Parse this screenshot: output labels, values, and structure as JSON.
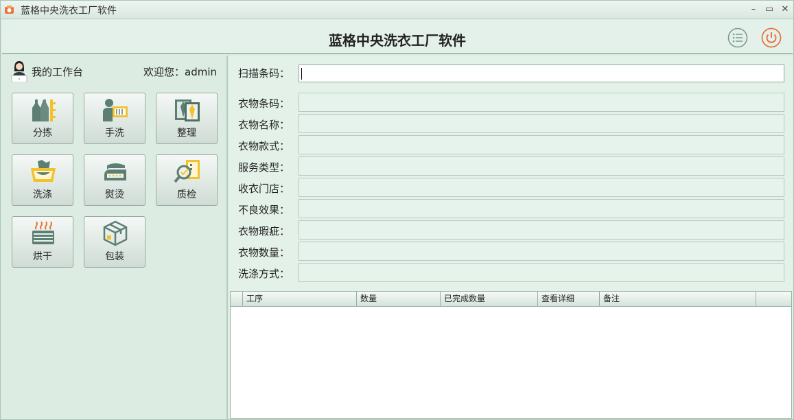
{
  "window": {
    "title": "蓝格中央洗衣工厂软件"
  },
  "header": {
    "title": "蓝格中央洗衣工厂软件",
    "menu_icon": "list-menu-icon",
    "power_icon": "power-icon"
  },
  "sidebar": {
    "workspace_label": "我的工作台",
    "welcome": "欢迎您：admin",
    "tiles": [
      {
        "label": "分拣",
        "icon": "sort-icon"
      },
      {
        "label": "手洗",
        "icon": "hand-wash-icon"
      },
      {
        "label": "整理",
        "icon": "tidy-icon"
      },
      {
        "label": "洗涤",
        "icon": "washing-icon"
      },
      {
        "label": "熨烫",
        "icon": "iron-icon"
      },
      {
        "label": "质检",
        "icon": "quality-check-icon"
      },
      {
        "label": "烘干",
        "icon": "dry-icon"
      },
      {
        "label": "包装",
        "icon": "package-icon"
      }
    ]
  },
  "form": {
    "scan_label": "扫描条码：",
    "scan_value": "",
    "fields": [
      {
        "label": "衣物条码：",
        "value": ""
      },
      {
        "label": "衣物名称：",
        "value": ""
      },
      {
        "label": "衣物款式：",
        "value": ""
      },
      {
        "label": "服务类型：",
        "value": ""
      },
      {
        "label": "收衣门店：",
        "value": ""
      },
      {
        "label": "不良效果：",
        "value": ""
      },
      {
        "label": "衣物瑕疵：",
        "value": ""
      },
      {
        "label": "衣物数量：",
        "value": ""
      },
      {
        "label": "洗涤方式：",
        "value": ""
      }
    ]
  },
  "table": {
    "columns": [
      "工序",
      "数量",
      "已完成数量",
      "查看详细",
      "备注"
    ],
    "rows": []
  },
  "colors": {
    "accent_orange": "#e8743b",
    "icon_teal": "#5d7f73",
    "icon_yellow": "#f2c12e"
  }
}
